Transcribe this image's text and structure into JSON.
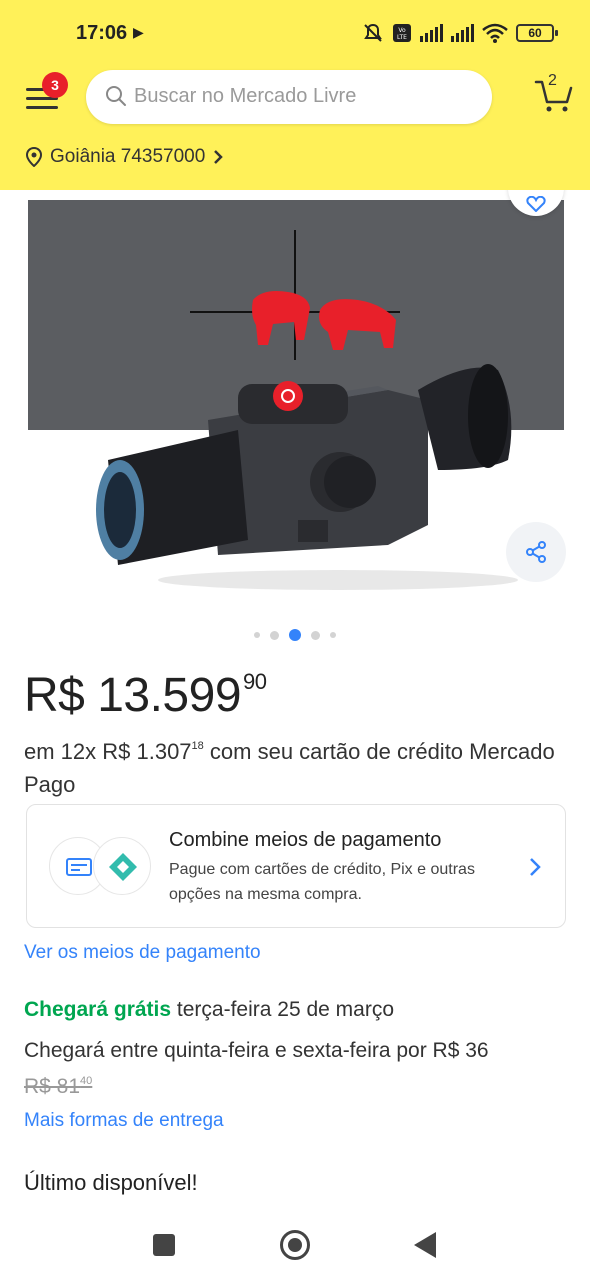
{
  "status_bar": {
    "time": "17:06",
    "play_glyph": "▶",
    "battery": "60",
    "icons": [
      "mute-icon",
      "volte-icon",
      "signal-icon",
      "signal-icon",
      "wifi-icon",
      "battery-icon"
    ]
  },
  "header": {
    "menu_badge": "3",
    "search_placeholder": "Buscar no Mercado Livre",
    "cart_count": "2",
    "location": "Goiânia 74357000",
    "brand_color": "#fff159"
  },
  "gallery": {
    "total_images": 5,
    "active_index": 2
  },
  "product": {
    "price_main": "R$ 13.599",
    "price_cents": "90",
    "installments_a": "em 12x R$ 1.307",
    "installments_cents": "18",
    "installments_b": " com seu cartão de crédito Mercado Pago"
  },
  "payment_card": {
    "title": "Combine meios de pagamento",
    "description": "Pague com cartões de crédito, Pix e outras opções na mesma compra."
  },
  "links": {
    "payment_methods": "Ver os meios de pagamento",
    "more_delivery": "Mais formas de entrega"
  },
  "delivery": {
    "free_label": "Chegará grátis",
    "free_date": " terça-feira 25 de março",
    "alt_text": "Chegará entre quinta-feira e sexta-feira por R$ 36",
    "old_price": "R$ 81",
    "old_cents": "40"
  },
  "stock": "Último disponível!",
  "colors": {
    "accent": "#3483fa",
    "green": "#00a650",
    "badge": "#e8202a"
  }
}
